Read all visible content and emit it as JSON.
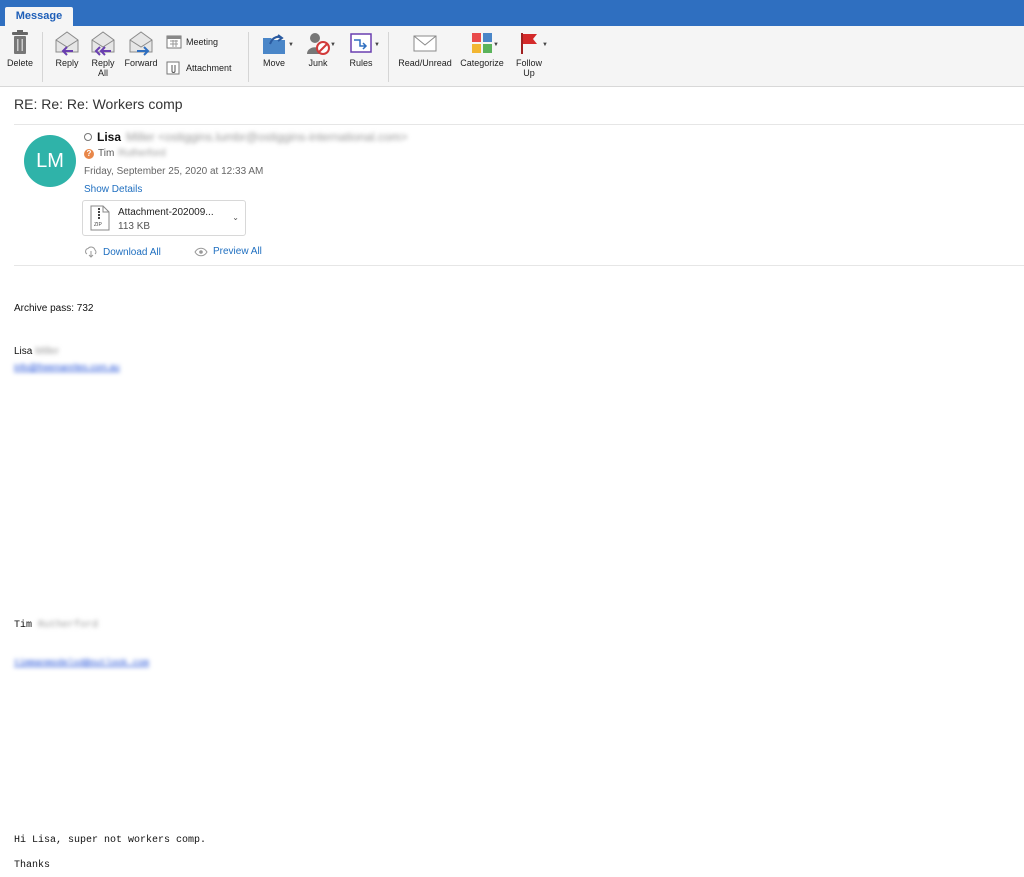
{
  "tab": {
    "label": "Message"
  },
  "ribbon": {
    "delete": "Delete",
    "reply": "Reply",
    "reply_all_line1": "Reply",
    "reply_all_line2": "All",
    "forward": "Forward",
    "meeting": "Meeting",
    "attachment": "Attachment",
    "move": "Move",
    "junk": "Junk",
    "rules": "Rules",
    "read_unread": "Read/Unread",
    "categorize": "Categorize",
    "follow_up_line1": "Follow",
    "follow_up_line2": "Up"
  },
  "message": {
    "subject": "RE: Re: Re: Workers comp",
    "avatar_initials": "LM",
    "from_first": "Lisa",
    "from_rest_blurred": "Miller <ostiggins.lumbr@ostiggins-international.com>",
    "to_first": "Tim",
    "to_rest_blurred": "Rutherford",
    "date": "Friday, September 25, 2020 at 12:33 AM",
    "show_details": "Show Details",
    "attachment": {
      "name": "Attachment-202009...",
      "size": "113 KB",
      "type_label": "ZIP"
    },
    "download_all": "Download All",
    "preview_all": "Preview All"
  },
  "body": {
    "archive_pass": "Archive pass: 732",
    "sig1_first": "Lisa",
    "sig1_last_blurred": "Miller",
    "sig1_email_blurred": "info@freemanrites.com.au",
    "sig2_first": "Tim",
    "sig2_last_blurred": "Rutherford",
    "sig2_email_blurred": "timmanmodelsd@outlook.com",
    "greeting": "Hi Lisa, super not workers comp.",
    "thanks": "Thanks"
  },
  "colors": {
    "accent": "#2f6fc0",
    "avatar": "#2fb3a9",
    "link": "#1f6fc0"
  }
}
